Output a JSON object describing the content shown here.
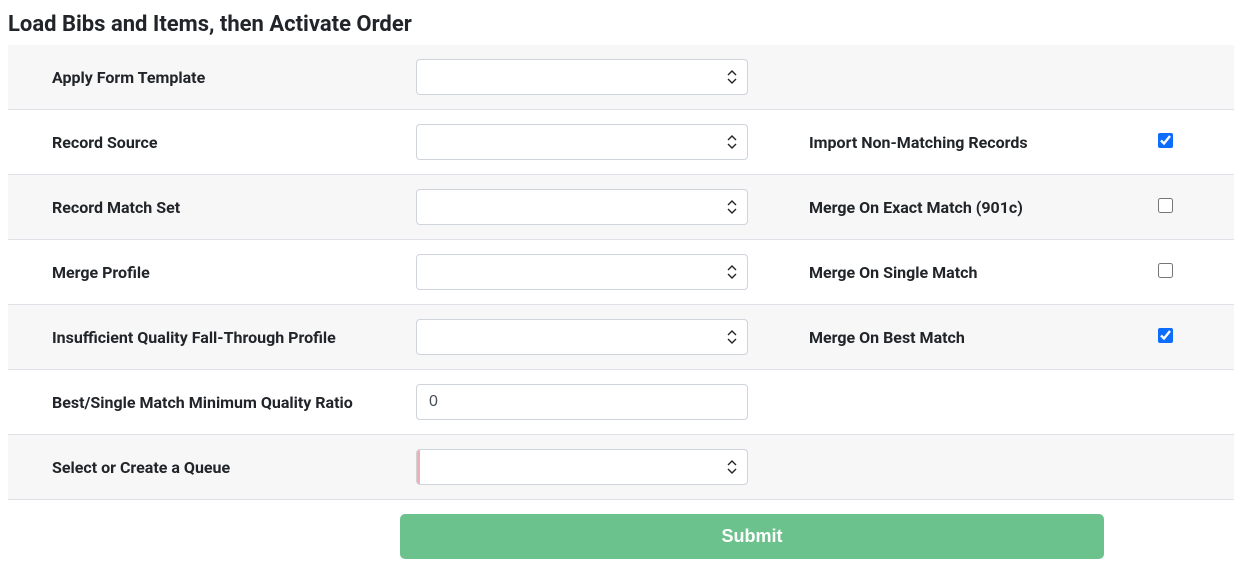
{
  "title": "Load Bibs and Items, then Activate Order",
  "rows": {
    "apply_form_template": {
      "label": "Apply Form Template"
    },
    "record_source": {
      "label": "Record Source",
      "check_label": "Import Non-Matching Records",
      "checked": true
    },
    "record_match_set": {
      "label": "Record Match Set",
      "check_label": "Merge On Exact Match (901c)",
      "checked": false
    },
    "merge_profile": {
      "label": "Merge Profile",
      "check_label": "Merge On Single Match",
      "checked": false
    },
    "insufficient_quality": {
      "label": "Insufficient Quality Fall-Through Profile",
      "check_label": "Merge On Best Match",
      "checked": true
    },
    "min_quality_ratio": {
      "label": "Best/Single Match Minimum Quality Ratio",
      "value": "0"
    },
    "select_queue": {
      "label": "Select or Create a Queue"
    }
  },
  "submit_label": "Submit"
}
